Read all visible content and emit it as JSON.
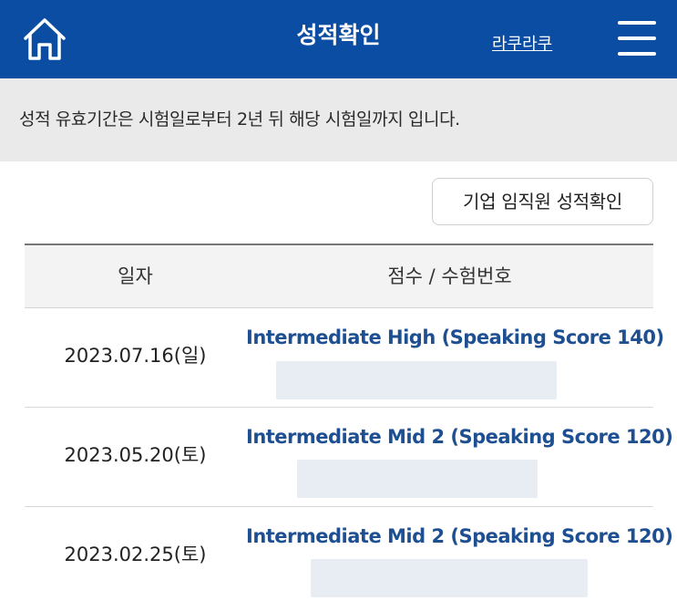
{
  "header": {
    "title": "성적확인",
    "user_name": "라쿠라쿠",
    "home_icon": "home-icon",
    "menu_icon": "hamburger-menu-icon",
    "background_color": "#0a4da2"
  },
  "notice": {
    "text": "성적 유효기간은 시험일로부터 2년 뒤 해당 시험일까지 입니다."
  },
  "corporate_button": {
    "label": "기업 임직원 성적확인"
  },
  "table": {
    "columns": [
      "일자",
      "점수 / 수험번호"
    ],
    "rows": [
      {
        "date": "2023.07.16(일)",
        "score": "Intermediate High (Speaking Score 140)"
      },
      {
        "date": "2023.05.20(토)",
        "score": "Intermediate Mid 2 (Speaking Score 120)"
      },
      {
        "date": "2023.02.25(토)",
        "score": "Intermediate Mid 2 (Speaking Score 120)"
      }
    ]
  },
  "colors": {
    "score_text": "#1e4f91",
    "notice_bg": "#eaeaea"
  }
}
